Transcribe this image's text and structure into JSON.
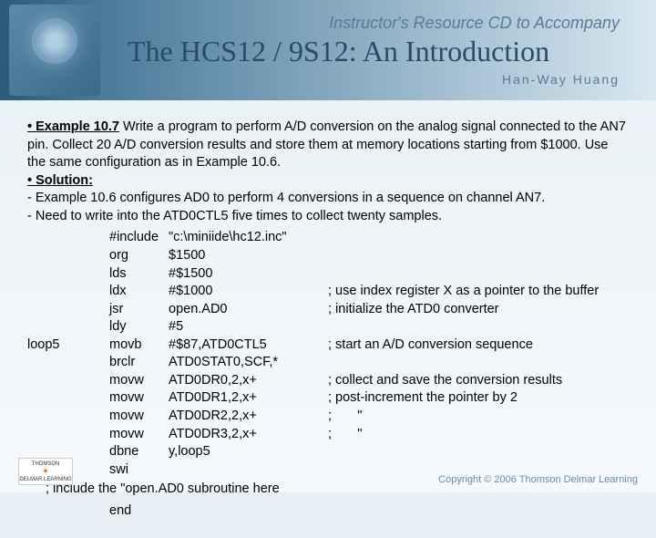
{
  "header": {
    "subtitle_top": "Instructor's Resource CD to Accompany",
    "title": "The HCS12 / 9S12: An Introduction",
    "author": "Han-Way Huang"
  },
  "content": {
    "example_label": "• Example 10.7",
    "example_text": "Write a program to perform A/D conversion on the analog signal connected to the AN7 pin. Collect 20 A/D conversion results and store them at memory locations starting from $1000. Use the same configuration as in Example 10.6.",
    "solution_label": "• Solution:",
    "sol_line1": "-  Example 10.6 configures AD0 to perform 4 conversions in a sequence on channel AN7.",
    "sol_line2": "-  Need to write into the ATD0CTL5 five times to collect twenty samples.",
    "code": [
      {
        "label": "",
        "op": "#include",
        "args": "\"c:\\miniide\\hc12.inc\"",
        "comment": ""
      },
      {
        "label": "",
        "op": "org",
        "args": "$1500",
        "comment": ""
      },
      {
        "label": "",
        "op": "lds",
        "args": "#$1500",
        "comment": ""
      },
      {
        "label": "",
        "op": "ldx",
        "args": "#$1000",
        "comment": "; use index register X as a pointer to the buffer"
      },
      {
        "label": "",
        "op": "jsr",
        "args": "open.AD0",
        "comment": "; initialize the ATD0 converter"
      },
      {
        "label": "",
        "op": "ldy",
        "args": "#5",
        "comment": ""
      },
      {
        "label": "loop5",
        "op": "movb",
        "args": "#$87,ATD0CTL5",
        "comment": "; start an A/D conversion sequence"
      },
      {
        "label": "",
        "op": "brclr",
        "args": "ATD0STAT0,SCF,*",
        "comment": ""
      },
      {
        "label": "",
        "op": "movw",
        "args": "ATD0DR0,2,x+",
        "comment": "; collect and save the conversion results"
      },
      {
        "label": "",
        "op": "movw",
        "args": "ATD0DR1,2,x+",
        "comment": "; post-increment the pointer by 2"
      },
      {
        "label": "",
        "op": "movw",
        "args": "ATD0DR2,2,x+",
        "comment": ";       \""
      },
      {
        "label": "",
        "op": "movw",
        "args": "ATD0DR3,2,x+",
        "comment": ";       \""
      },
      {
        "label": "",
        "op": "dbne",
        "args": "y,loop5",
        "comment": ""
      },
      {
        "label": "",
        "op": "swi",
        "args": "",
        "comment": ""
      }
    ],
    "include_note": "; include the \"open.AD0 subroutine here",
    "end_line": {
      "label": "",
      "op": "end",
      "args": "",
      "comment": ""
    }
  },
  "footer": {
    "publisher_top": "THOMSON",
    "publisher_bottom": "DELMAR LEARNING",
    "copyright": "Copyright © 2006 Thomson Delmar Learning"
  }
}
